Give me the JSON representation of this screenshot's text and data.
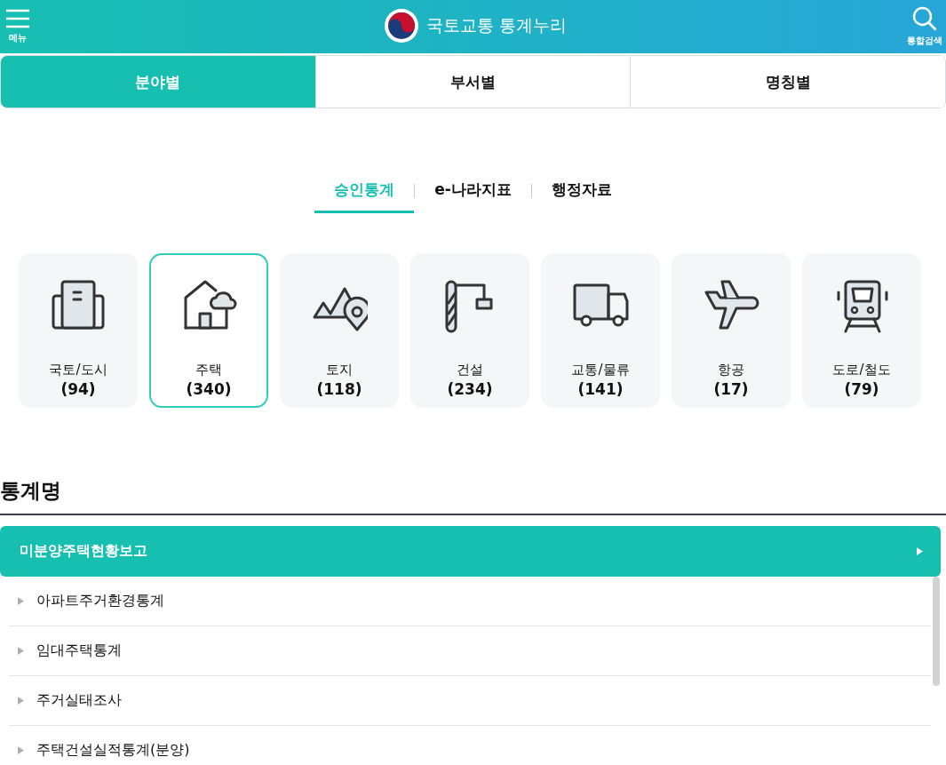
{
  "header": {
    "menu_label": "메뉴",
    "title": "국토교통 통계누리",
    "search_label": "통합검색"
  },
  "main_tabs": [
    {
      "label": "분야별",
      "selected": true
    },
    {
      "label": "부서별",
      "selected": false
    },
    {
      "label": "명칭별",
      "selected": false
    }
  ],
  "sub_tabs": [
    {
      "label": "승인통계",
      "selected": true
    },
    {
      "label": "e-나라지표",
      "selected": false
    },
    {
      "label": "행정자료",
      "selected": false
    }
  ],
  "categories": [
    {
      "kind": "building",
      "name": "국토/도시",
      "count": "(94)",
      "selected": false
    },
    {
      "kind": "house",
      "name": "주택",
      "count": "(340)",
      "selected": true
    },
    {
      "kind": "land",
      "name": "토지",
      "count": "(118)",
      "selected": false
    },
    {
      "kind": "crane",
      "name": "건설",
      "count": "(234)",
      "selected": false
    },
    {
      "kind": "truck",
      "name": "교통/물류",
      "count": "(141)",
      "selected": false
    },
    {
      "kind": "plane",
      "name": "항공",
      "count": "(17)",
      "selected": false
    },
    {
      "kind": "train",
      "name": "도로/철도",
      "count": "(79)",
      "selected": false
    }
  ],
  "list_title": "통계명",
  "statistics": [
    {
      "name": "미분양주택현황보고",
      "selected": true
    },
    {
      "name": "아파트주거환경통계",
      "selected": false
    },
    {
      "name": "임대주택통계",
      "selected": false
    },
    {
      "name": "주거실태조사",
      "selected": false
    },
    {
      "name": "주택건설실적통계(분양)",
      "selected": false
    }
  ]
}
